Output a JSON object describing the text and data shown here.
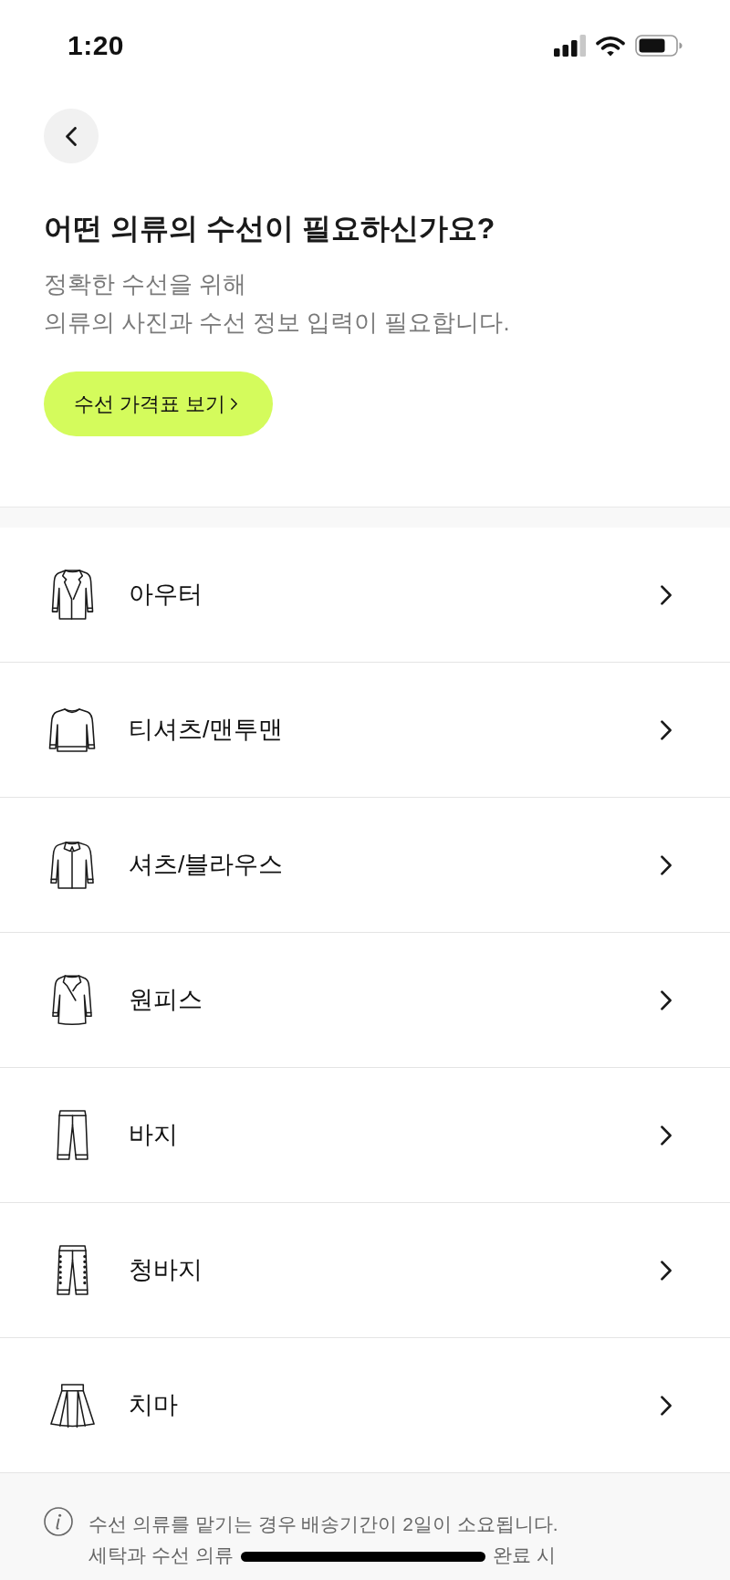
{
  "status_bar": {
    "time": "1:20"
  },
  "header": {
    "title": "어떤 의류의 수선이 필요하신가요?",
    "description": [
      "정확한 수선을 위해",
      "의류의 사진과 수선 정보 입력이 필요합니다."
    ],
    "price_table_button": {
      "label": "수선 가격표 보기"
    }
  },
  "categories": [
    {
      "label": "아우터",
      "kind": "jacket"
    },
    {
      "label": "티셔츠/맨투맨",
      "kind": "sweatshirt"
    },
    {
      "label": "셔츠/블라우스",
      "kind": "shirt"
    },
    {
      "label": "원피스",
      "kind": "dress"
    },
    {
      "label": "바지",
      "kind": "pants"
    },
    {
      "label": "청바지",
      "kind": "jeans"
    },
    {
      "label": "치마",
      "kind": "skirt"
    }
  ],
  "notice": {
    "lines": [
      [
        "수선 의류를 맡기는 경우 배송기간이 2일이 소요됩니다."
      ],
      [
        "세탁과 수선 의류",
        "완료 시"
      ]
    ]
  }
}
